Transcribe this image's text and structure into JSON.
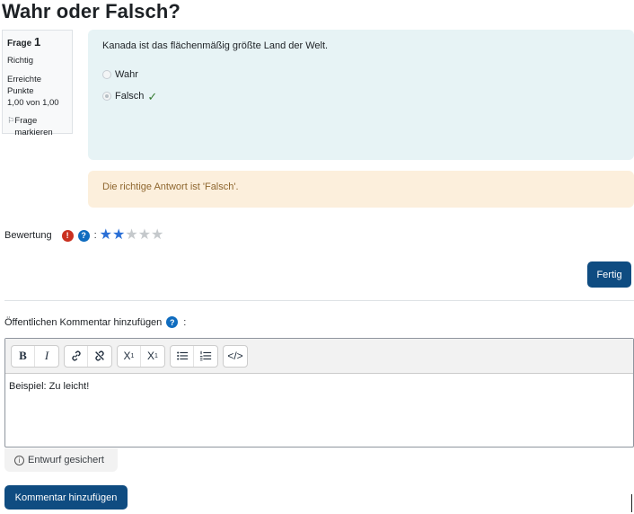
{
  "page": {
    "title": "Wahr oder Falsch?"
  },
  "question_info": {
    "label": "Frage",
    "number": "1",
    "state": "Richtig",
    "grade_label": "Erreichte Punkte",
    "grade_value": "1,00 von 1,00",
    "flag_label": "Frage markieren"
  },
  "question": {
    "text": "Kanada ist das flächenmäßig größte Land der Welt.",
    "options": [
      {
        "label": "Wahr",
        "checked": false,
        "correct": false
      },
      {
        "label": "Falsch",
        "checked": true,
        "correct": true
      }
    ]
  },
  "feedback": {
    "text": "Die richtige Antwort ist 'Falsch'."
  },
  "rating": {
    "label": "Bewertung",
    "colon": ":",
    "value": 2,
    "max": 5
  },
  "buttons": {
    "fertig": "Fertig",
    "add_comment": "Kommentar hinzufügen"
  },
  "comment": {
    "label": "Öffentlichen Kommentar hinzufügen",
    "colon": ":",
    "content": "Beispiel: Zu leicht!",
    "status": "Entwurf gesichert"
  },
  "toolbar": {
    "bold": "B",
    "italic": "I",
    "superscript": "X",
    "superscript_mark": "1",
    "subscript": "X",
    "subscript_mark": "1",
    "code": "</>"
  },
  "icons": {
    "flag": "flag-icon",
    "error": "exclamation-icon",
    "help": "question-icon",
    "check": "check-icon",
    "info": "info-icon"
  },
  "colors": {
    "primary_button": "#0f4c81",
    "question_bg": "#e7f3f5",
    "feedback_bg": "#fcefdc",
    "feedback_text": "#8e662e",
    "star_on": "#2a6fd6",
    "star_off": "#c5c9cc",
    "error_badge": "#ca3120",
    "help_badge": "#0f6cbf",
    "check": "#357a32"
  }
}
